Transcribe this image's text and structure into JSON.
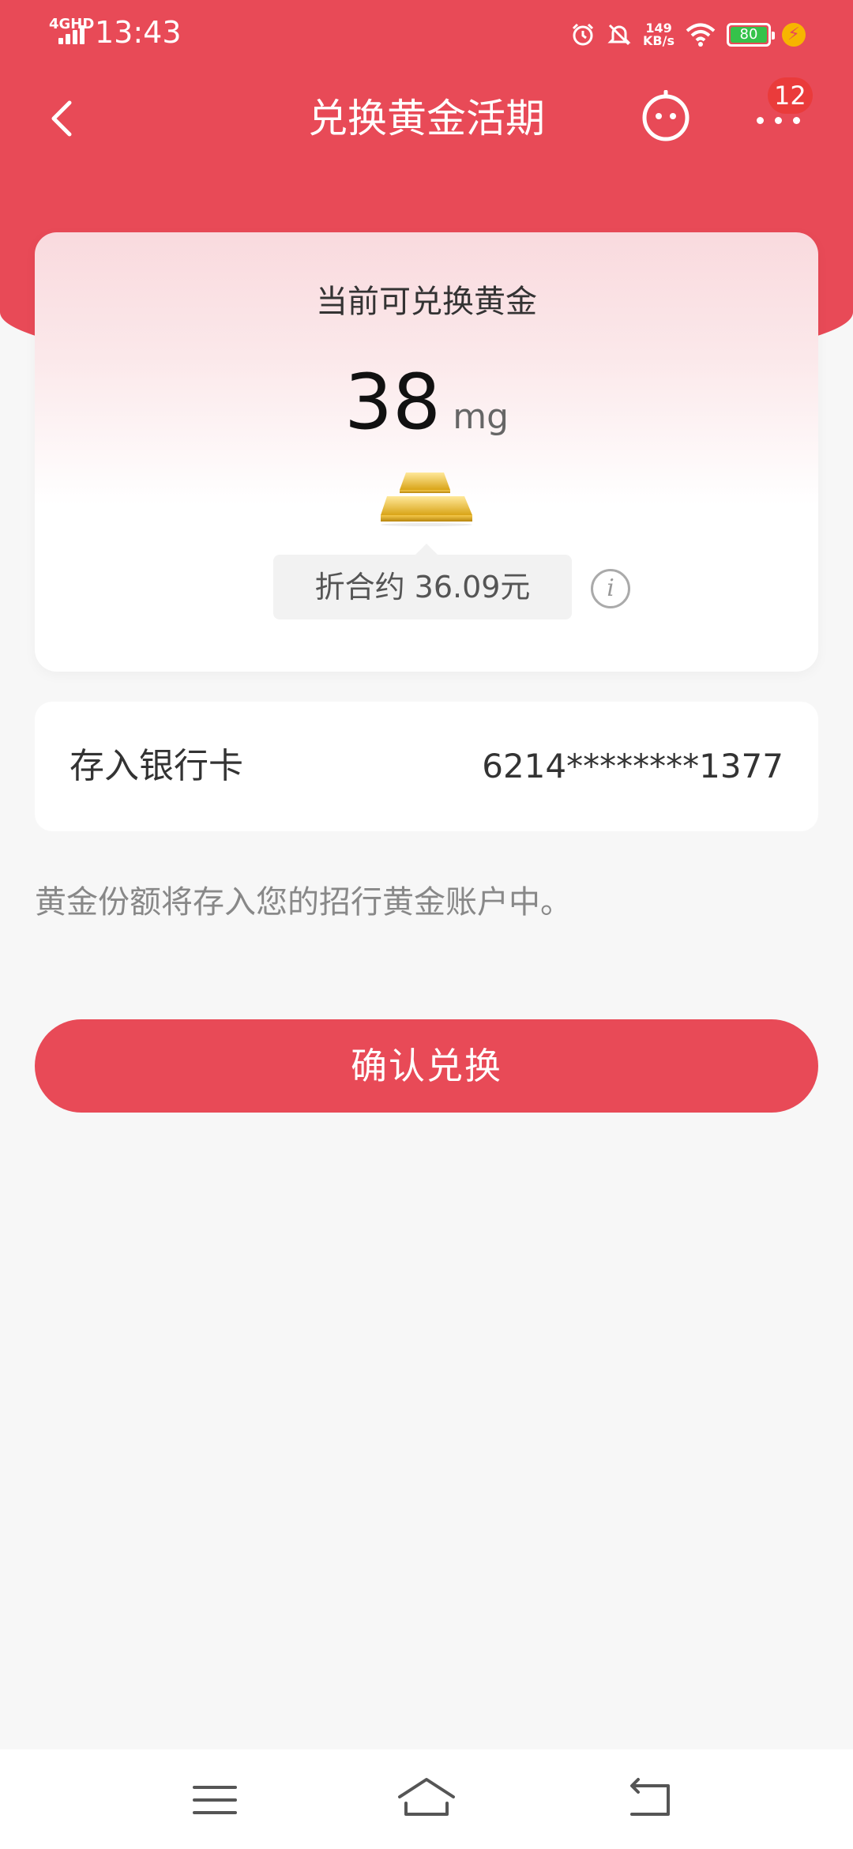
{
  "status_bar": {
    "network": "4GHD",
    "time": "13:43",
    "speed_value": "149",
    "speed_unit": "KB/s",
    "battery": "80"
  },
  "nav": {
    "title": "兑换黄金活期",
    "badge_count": "12",
    "icons": [
      "back-icon",
      "robot-assistant-icon",
      "more-icon"
    ]
  },
  "gold_card": {
    "label": "当前可兑换黄金",
    "amount": "38",
    "unit": "mg",
    "approx": "折合约 36.09元",
    "info_icon_text": "i"
  },
  "bank": {
    "label": "存入银行卡",
    "card_number": "6214********1377"
  },
  "note": "黄金份额将存入您的招行黄金账户中。",
  "confirm_label": "确认兑换",
  "colors": {
    "brand_red": "#e84a57",
    "background": "#f7f7f7",
    "badge_red": "#ea3b3b",
    "battery_green": "#35c24a"
  },
  "system_nav": [
    "menu-icon",
    "home-icon",
    "back-nav-icon"
  ]
}
